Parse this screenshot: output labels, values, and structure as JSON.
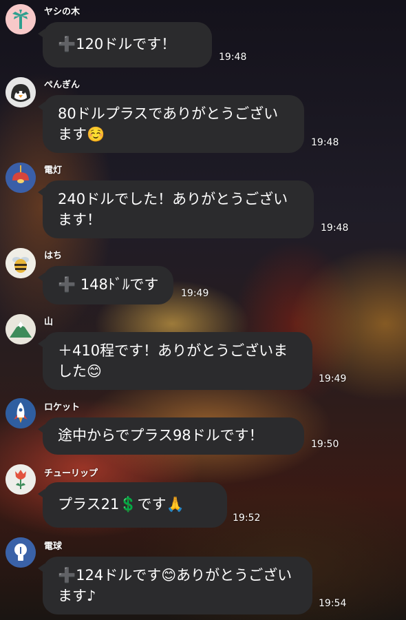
{
  "messages": [
    {
      "name": "ヤシの木",
      "avatar": "palm-tree-icon",
      "avatar_bg": "#f7c9c9",
      "text": "➕120ドルです！",
      "time": "19:48"
    },
    {
      "name": "ぺんぎん",
      "avatar": "penguin-icon",
      "avatar_bg": "#e6e6e6",
      "text": "80ドルプラスでありがとうございます☺️",
      "time": "19:48"
    },
    {
      "name": "電灯",
      "avatar": "lamp-icon",
      "avatar_bg": "#3a5fa8",
      "text": "240ドルでした！ありがとうございます！",
      "time": "19:48"
    },
    {
      "name": "はち",
      "avatar": "bee-icon",
      "avatar_bg": "#f0eee6",
      "text": "➕ 148ﾄﾞﾙです",
      "time": "19:49"
    },
    {
      "name": "山",
      "avatar": "mountain-icon",
      "avatar_bg": "#e9e6dc",
      "text": "＋410程です！ありがとうございました😊",
      "time": "19:49"
    },
    {
      "name": "ロケット",
      "avatar": "rocket-icon",
      "avatar_bg": "#2f5ea0",
      "text": "途中からでプラス98ドルです！",
      "time": "19:50"
    },
    {
      "name": "チューリップ",
      "avatar": "tulip-icon",
      "avatar_bg": "#eeeeea",
      "text": "プラス21💲です🙏",
      "time": "19:52"
    },
    {
      "name": "電球",
      "avatar": "lightbulb-icon",
      "avatar_bg": "#3a62a8",
      "text": "➕124ドルです😊ありがとうございます♪",
      "time": "19:54"
    }
  ]
}
